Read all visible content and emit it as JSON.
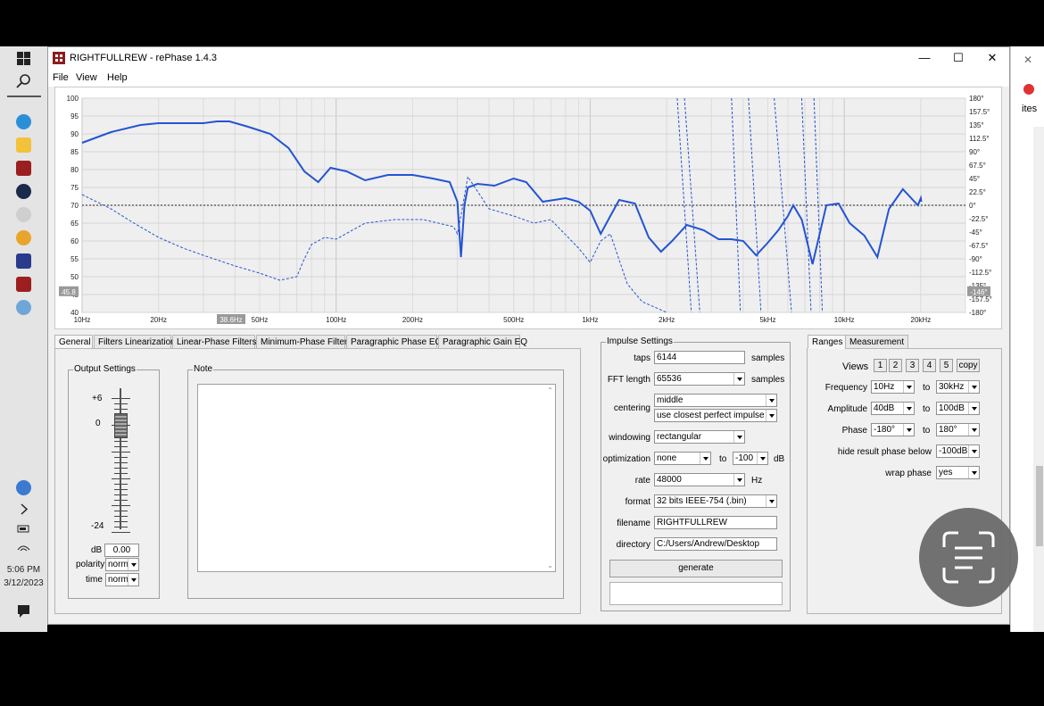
{
  "window": {
    "title": "RIGHTFULLREW  -  rePhase 1.4.3"
  },
  "menu": [
    "File",
    "View",
    "Help"
  ],
  "taskbar": {
    "time": "5:06 PM",
    "date": "3/12/2023"
  },
  "background_window": {
    "peek_text": "ites"
  },
  "chart_data": {
    "type": "line",
    "x_ticks": [
      "10Hz",
      "20Hz",
      "50Hz",
      "100Hz",
      "200Hz",
      "500Hz",
      "1kHz",
      "2kHz",
      "5kHz",
      "10kHz",
      "20kHz"
    ],
    "y_ticks_left": [
      "100",
      "95",
      "90",
      "85",
      "80",
      "75",
      "70",
      "65",
      "60",
      "55",
      "50",
      "45",
      "40"
    ],
    "y_ticks_right": [
      "180°",
      "157.5°",
      "135°",
      "112.5°",
      "90°",
      "67.5°",
      "45°",
      "22.5°",
      "0°",
      "-22.5°",
      "-45°",
      "-67.5°",
      "-90°",
      "-112.5°",
      "-135°",
      "-157.5°",
      "-180°"
    ],
    "xlim": [
      10,
      30000
    ],
    "ylim_left": [
      40,
      100
    ],
    "ylim_right": [
      -180,
      180
    ],
    "x_scale": "log",
    "grid": true,
    "cursor_x_label": "38.6Hz",
    "cursor_y_left_label": "45.8",
    "cursor_y_right_label": "-146°",
    "reference_line_db": 70,
    "series": [
      {
        "style": "solid",
        "color": "#2453d4",
        "x": [
          10,
          13,
          17,
          20,
          25,
          30,
          34,
          38,
          45,
          55,
          65,
          75,
          85,
          95,
          110,
          130,
          160,
          200,
          240,
          280,
          300,
          310,
          320,
          330,
          360,
          420,
          500,
          560,
          650,
          800,
          900,
          1000,
          1100,
          1200,
          1300,
          1500,
          1700,
          1900,
          2100,
          2400,
          2800,
          3200,
          3600,
          4000,
          4500,
          5000,
          5500,
          6000,
          6300,
          6800,
          7500,
          8500,
          9500,
          10500,
          12000,
          13500,
          15000,
          17000,
          19500,
          20000,
          20100
        ],
        "y": [
          87.5,
          90.5,
          92.5,
          93,
          93,
          93,
          93.5,
          93.5,
          92,
          90,
          86,
          79.5,
          76.5,
          80.5,
          79.5,
          77,
          78.5,
          78.5,
          77.5,
          76.5,
          71,
          55.5,
          70,
          75,
          76,
          75.5,
          77.5,
          76.5,
          71,
          72,
          71,
          68.5,
          62,
          67,
          71.5,
          70.5,
          61,
          57,
          60,
          64.5,
          63,
          60.5,
          60.5,
          60,
          56,
          59.5,
          63,
          67,
          70,
          66,
          53.5,
          70,
          70.5,
          65,
          61.5,
          55.5,
          69,
          74.5,
          70,
          72,
          71
        ],
        "y_right_axis": false
      },
      {
        "style": "dashed",
        "color": "#2453d4",
        "x": [
          10,
          13,
          16,
          20,
          25,
          30,
          40,
          50,
          60,
          70,
          75,
          80,
          90,
          100,
          130,
          170,
          220,
          290,
          300,
          310,
          330,
          400,
          500,
          600,
          700,
          900,
          1000,
          1100,
          1200,
          1400,
          1600,
          2000
        ],
        "y": [
          73,
          69,
          65,
          61,
          58,
          56,
          53,
          51,
          49,
          50,
          55,
          59,
          61,
          60.5,
          65,
          66,
          66,
          64,
          62,
          67,
          78,
          69,
          67,
          65,
          66,
          58,
          54,
          60,
          62,
          48,
          43,
          40
        ],
        "y_right_axis": false
      }
    ]
  },
  "tabs": [
    "General",
    "Filters Linearization",
    "Linear-Phase Filters",
    "Minimum-Phase Filters",
    "Paragraphic Phase EQ",
    "Paragraphic Gain EQ"
  ],
  "output_settings": {
    "title": "Output Settings",
    "scale_top": "+6",
    "scale_zero": "0",
    "scale_bottom": "-24",
    "db_label": "dB",
    "db_value": "0.00",
    "polarity_label": "polarity",
    "polarity_value": "norm",
    "time_label": "time",
    "time_value": "norm"
  },
  "note": {
    "title": "Note",
    "text": ""
  },
  "impulse": {
    "title": "Impulse Settings",
    "taps_label": "taps",
    "taps_value": "6144",
    "taps_unit": "samples",
    "fft_label": "FFT length",
    "fft_value": "65536",
    "fft_unit": "samples",
    "centering_label": "centering",
    "centering_value": "middle",
    "centering_mode": "use closest perfect impulse",
    "windowing_label": "windowing",
    "windowing_value": "rectangular",
    "optimization_label": "optimization",
    "optimization_value": "none",
    "optimization_to": "to",
    "optimization_db": "-100",
    "optimization_unit": "dB",
    "rate_label": "rate",
    "rate_value": "48000",
    "rate_unit": "Hz",
    "format_label": "format",
    "format_value": "32 bits IEEE-754 (.bin)",
    "filename_label": "filename",
    "filename_value": "RIGHTFULLREW",
    "directory_label": "directory",
    "directory_value": "C:/Users/Andrew/Desktop",
    "generate_label": "generate"
  },
  "ranges": {
    "tabs": [
      "Ranges",
      "Measurement"
    ],
    "views_label": "Views",
    "views": [
      "1",
      "2",
      "3",
      "4",
      "5",
      "copy"
    ],
    "frequency_label": "Frequency",
    "frequency_from": "10Hz",
    "frequency_to": "30kHz",
    "amplitude_label": "Amplitude",
    "amplitude_from": "40dB",
    "amplitude_to": "100dB",
    "phase_label": "Phase",
    "phase_from": "-180°",
    "phase_to": "180°",
    "to_label": "to",
    "hide_label": "hide result phase below",
    "hide_value": "-100dB",
    "wrap_label": "wrap phase",
    "wrap_value": "yes"
  }
}
